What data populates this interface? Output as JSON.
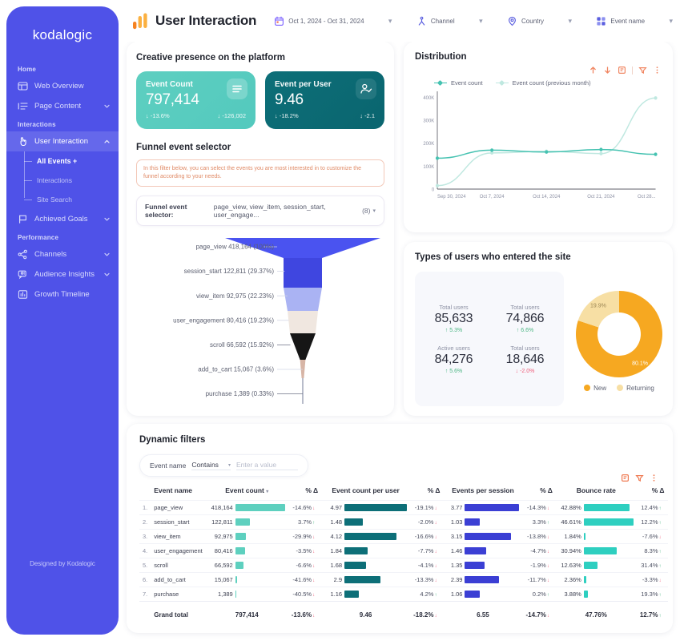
{
  "sidebar": {
    "brand": "kodalogic",
    "footer": "Designed by Kodalogic",
    "sections": [
      {
        "label": "Home",
        "items": [
          {
            "label": "Web Overview",
            "icon": "web-overview-icon",
            "chevron": false
          },
          {
            "label": "Page Content",
            "icon": "page-content-icon",
            "chevron": true
          }
        ]
      },
      {
        "label": "Interactions",
        "items": [
          {
            "label": "User Interaction",
            "icon": "user-interaction-icon",
            "chevron": true,
            "active": true,
            "children": [
              {
                "label": "All Events +",
                "current": true
              },
              {
                "label": "Interactions",
                "current": false
              },
              {
                "label": "Site Search",
                "current": false
              }
            ]
          },
          {
            "label": "Achieved Goals",
            "icon": "flag-icon",
            "chevron": true
          }
        ]
      },
      {
        "label": "Performance",
        "items": [
          {
            "label": "Channels",
            "icon": "channels-icon",
            "chevron": true
          },
          {
            "label": "Audience Insights",
            "icon": "audience-insights-icon",
            "chevron": true
          },
          {
            "label": "Growth Timeline",
            "icon": "growth-timeline-icon",
            "chevron": false
          }
        ]
      }
    ]
  },
  "header": {
    "title": "User Interaction",
    "logo": "analytics-bars-icon",
    "filters": [
      {
        "label": "Oct 1, 2024 - Oct 31, 2024",
        "icon": "calendar-icon"
      },
      {
        "label": "Channel",
        "icon": "channel-icon"
      },
      {
        "label": "Country",
        "icon": "location-pin-icon"
      },
      {
        "label": "Event name",
        "icon": "grid-icon"
      }
    ],
    "separator": "▾"
  },
  "creative": {
    "title": "Creative presence on the platform",
    "kpis": [
      {
        "name": "Event Count",
        "value": "797,414",
        "delta_pct": "-13.6%",
        "delta_abs": "-126,002",
        "icon": "list-lines-icon",
        "theme": "teal"
      },
      {
        "name": "Event per User",
        "value": "9.46",
        "delta_pct": "-18.2%",
        "delta_abs": "-2.1",
        "icon": "user-check-icon",
        "theme": "dark"
      }
    ]
  },
  "funnel": {
    "title": "Funnel event selector",
    "hint": "In this filter below, you can select the events you are most interested in to customize the funnel according to your needs.",
    "selector_label": "Funnel event selector:",
    "selector_value": "page_view, view_item, session_start, user_engage...",
    "selector_count": "(8)",
    "caret": "▾",
    "steps": [
      {
        "label": "page_view 418,164 (100%)",
        "name": "page_view",
        "count": 418164,
        "pct": 100,
        "color": "#4a53f0"
      },
      {
        "label": "session_start 122,811 (29.37%)",
        "name": "session_start",
        "count": 122811,
        "pct": 29.37,
        "color": "#4a53f0"
      },
      {
        "label": "view_item 92,975 (22.23%)",
        "name": "view_item",
        "count": 92975,
        "pct": 22.23,
        "color": "#aab3f3"
      },
      {
        "label": "user_engagement 80,416 (19.23%)",
        "name": "user_engagement",
        "count": 80416,
        "pct": 19.23,
        "color": "#f0e7e0"
      },
      {
        "label": "scroll 66,592 (15.92%)",
        "name": "scroll",
        "count": 66592,
        "pct": 15.92,
        "color": "#161616"
      },
      {
        "label": "add_to_cart 15,067 (3.6%)",
        "name": "add_to_cart",
        "count": 15067,
        "pct": 3.6,
        "color": "#d7b5a6"
      },
      {
        "label": "purchase 1,389 (0.33%)",
        "name": "purchase",
        "count": 1389,
        "pct": 0.33,
        "color": "#9aa0b4"
      }
    ]
  },
  "distribution": {
    "title": "Distribution",
    "tools": [
      "arrow-up-icon",
      "arrow-down-icon",
      "export-icon",
      "filter-icon",
      "more-vertical-icon"
    ],
    "chart_data": {
      "type": "line",
      "title": "Distribution",
      "xlabel": "",
      "ylabel": "",
      "ylim": [
        0,
        420000
      ],
      "yticks": [
        "0",
        "100K",
        "200K",
        "300K",
        "400K"
      ],
      "grid": false,
      "legend_position": "top-left",
      "x": [
        "Sep 30, 2024",
        "Oct 7, 2024",
        "Oct 14, 2024",
        "Oct 21, 2024",
        "Oct 28..."
      ],
      "series": [
        {
          "name": "Event count",
          "color": "#45c2b1",
          "values": [
            135000,
            170000,
            162000,
            173000,
            152000
          ]
        },
        {
          "name": "Event count (previous month)",
          "color": "#bfe8e0",
          "values": [
            15000,
            158000,
            165000,
            155000,
            398000
          ]
        }
      ]
    }
  },
  "users": {
    "title": "Types of users who entered the site",
    "stats": [
      {
        "label": "Total users",
        "value": "85,633",
        "delta": "5.3%",
        "dir": "up"
      },
      {
        "label": "Total users",
        "value": "74,866",
        "delta": "6.6%",
        "dir": "up"
      },
      {
        "label": "Active users",
        "value": "84,276",
        "delta": "5.6%",
        "dir": "up"
      },
      {
        "label": "Total users",
        "value": "18,646",
        "delta": "-2.0%",
        "dir": "down"
      }
    ],
    "chart_data": {
      "type": "pie",
      "title": "Types of users who entered the site",
      "labels": [
        "New",
        "Returning"
      ],
      "values": [
        80.1,
        19.9
      ],
      "value_labels": [
        "80.1%",
        "19.9%"
      ],
      "colors": [
        "#f6a821",
        "#f7dfa4"
      ],
      "legend_position": "bottom"
    }
  },
  "dynamic": {
    "title": "Dynamic filters",
    "tools": [
      "export-icon",
      "filter-icon",
      "more-vertical-icon"
    ],
    "filter": {
      "field_label": "Event name",
      "operator": "Contains",
      "caret": "▾",
      "placeholder": "Enter a value",
      "value": ""
    },
    "columns": [
      {
        "label": "Event name",
        "sorted": false
      },
      {
        "label": "Event count",
        "sorted": true,
        "caret": "▾"
      },
      {
        "label": "% Δ",
        "sorted": false
      },
      {
        "label": "Event count per user",
        "sorted": false
      },
      {
        "label": "% Δ",
        "sorted": false
      },
      {
        "label": "Events per session",
        "sorted": false
      },
      {
        "label": "% Δ",
        "sorted": false
      },
      {
        "label": "Bounce rate",
        "sorted": false
      },
      {
        "label": "% Δ",
        "sorted": false
      }
    ],
    "bar_colors": {
      "event_count": "#5ed0bf",
      "per_user": "#0d6f78",
      "per_session": "#3b3fd4",
      "bounce": "#2ecfc0"
    },
    "rows": [
      {
        "idx": "1.",
        "name": "page_view",
        "count": "418,164",
        "count_w": 100,
        "count_d": "-14.6%",
        "count_dir": "down",
        "per_user": "4.97",
        "per_user_w": 100,
        "per_user_d": "-19.1%",
        "per_user_dir": "down",
        "per_session": "3.77",
        "per_session_w": 100,
        "per_session_d": "-14.3%",
        "per_session_dir": "down",
        "bounce": "42.88%",
        "bounce_w": 92,
        "bounce_d": "12.4%",
        "bounce_dir": "up"
      },
      {
        "idx": "2.",
        "name": "session_start",
        "count": "122,811",
        "count_w": 29,
        "count_d": "3.7%",
        "count_dir": "up",
        "per_user": "1.48",
        "per_user_w": 30,
        "per_user_d": "-2.0%",
        "per_user_dir": "down",
        "per_session": "1.03",
        "per_session_w": 27,
        "per_session_d": "3.3%",
        "per_session_dir": "up",
        "bounce": "46.61%",
        "bounce_w": 100,
        "bounce_d": "12.2%",
        "bounce_dir": "up"
      },
      {
        "idx": "3.",
        "name": "view_item",
        "count": "92,975",
        "count_w": 22,
        "count_d": "-29.9%",
        "count_dir": "down",
        "per_user": "4.12",
        "per_user_w": 83,
        "per_user_d": "-16.6%",
        "per_user_dir": "down",
        "per_session": "3.15",
        "per_session_w": 84,
        "per_session_d": "-13.8%",
        "per_session_dir": "down",
        "bounce": "1.84%",
        "bounce_w": 4,
        "bounce_d": "-7.6%",
        "bounce_dir": "down"
      },
      {
        "idx": "4.",
        "name": "user_engagement",
        "count": "80,416",
        "count_w": 19,
        "count_d": "-3.5%",
        "count_dir": "down",
        "per_user": "1.84",
        "per_user_w": 37,
        "per_user_d": "-7.7%",
        "per_user_dir": "down",
        "per_session": "1.46",
        "per_session_w": 39,
        "per_session_d": "-4.7%",
        "per_session_dir": "down",
        "bounce": "30.94%",
        "bounce_w": 66,
        "bounce_d": "8.3%",
        "bounce_dir": "up"
      },
      {
        "idx": "5.",
        "name": "scroll",
        "count": "66,592",
        "count_w": 16,
        "count_d": "-6.6%",
        "count_dir": "down",
        "per_user": "1.68",
        "per_user_w": 34,
        "per_user_d": "-4.1%",
        "per_user_dir": "down",
        "per_session": "1.35",
        "per_session_w": 36,
        "per_session_d": "-1.9%",
        "per_session_dir": "down",
        "bounce": "12.63%",
        "bounce_w": 27,
        "bounce_d": "31.4%",
        "bounce_dir": "up"
      },
      {
        "idx": "6.",
        "name": "add_to_cart",
        "count": "15,067",
        "count_w": 4,
        "count_d": "-41.6%",
        "count_dir": "down",
        "per_user": "2.9",
        "per_user_w": 58,
        "per_user_d": "-13.3%",
        "per_user_dir": "down",
        "per_session": "2.39",
        "per_session_w": 63,
        "per_session_d": "-11.7%",
        "per_session_dir": "down",
        "bounce": "2.36%",
        "bounce_w": 5,
        "bounce_d": "-3.3%",
        "bounce_dir": "down"
      },
      {
        "idx": "7.",
        "name": "purchase",
        "count": "1,389",
        "count_w": 2,
        "count_d": "-40.5%",
        "count_dir": "down",
        "per_user": "1.16",
        "per_user_w": 23,
        "per_user_d": "4.2%",
        "per_user_dir": "up",
        "per_session": "1.06",
        "per_session_w": 28,
        "per_session_d": "0.2%",
        "per_session_dir": "up",
        "bounce": "3.88%",
        "bounce_w": 8,
        "bounce_d": "19.3%",
        "bounce_dir": "up"
      }
    ],
    "grand_total": {
      "label": "Grand total",
      "count": "797,414",
      "count_d": "-13.6%",
      "count_dir": "down",
      "per_user": "9.46",
      "per_user_d": "-18.2%",
      "per_user_dir": "down",
      "per_session": "6.55",
      "per_session_d": "-14.7%",
      "per_session_dir": "down",
      "bounce": "47.76%",
      "bounce_d": "12.7%",
      "bounce_dir": "up"
    }
  }
}
